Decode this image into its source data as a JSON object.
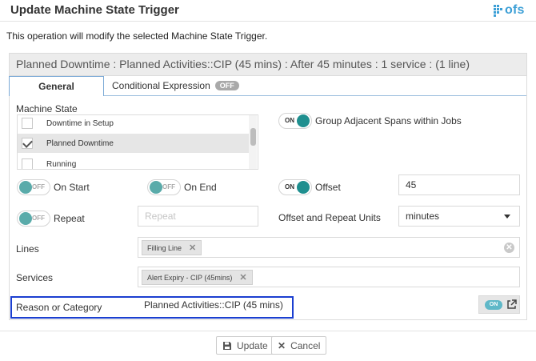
{
  "window": {
    "title": "Update Machine State Trigger",
    "logo_text": "ofs"
  },
  "intro": "This operation will modify the selected Machine State Trigger.",
  "panel": {
    "header": "Planned Downtime : Planned Activities::CIP (45 mins) : After 45 minutes : 1 service : (1 line)"
  },
  "tabs": [
    {
      "label": "General",
      "active": true
    },
    {
      "label": "Conditional Expression",
      "badge": "OFF"
    }
  ],
  "machine_state": {
    "label": "Machine State",
    "items": [
      {
        "label": "Downtime in Setup",
        "checked": false
      },
      {
        "label": "Planned Downtime",
        "checked": true
      },
      {
        "label": "Running",
        "checked": false
      }
    ]
  },
  "group_adjacent": {
    "state": "ON",
    "label": "Group Adjacent Spans within Jobs"
  },
  "on_start": {
    "state": "OFF",
    "label": "On Start"
  },
  "on_end": {
    "state": "OFF",
    "label": "On End"
  },
  "offset": {
    "state": "ON",
    "label": "Offset",
    "value": "45"
  },
  "repeat": {
    "state": "OFF",
    "label": "Repeat",
    "placeholder": "Repeat"
  },
  "units": {
    "label": "Offset and Repeat Units",
    "selected": "minutes"
  },
  "lines": {
    "label": "Lines",
    "tags": [
      "Filling Line"
    ]
  },
  "services": {
    "label": "Services",
    "tags": [
      "Alert Expiry - CIP (45mins)"
    ]
  },
  "reason": {
    "label": "Reason or Category",
    "value": "Planned Activities::CIP (45 mins)",
    "toggle": "ON"
  },
  "footer": {
    "update_label": "Update",
    "cancel_label": "Cancel"
  },
  "colors": {
    "accent": "#1f8f8f",
    "highlight": "#1b3fd0",
    "logo": "#3c9fd6"
  },
  "icons": [
    "ofs-logo-icon",
    "check-icon",
    "remove-tag-icon",
    "clear-icon",
    "external-link-icon",
    "save-icon",
    "close-icon",
    "caret-down-icon"
  ]
}
